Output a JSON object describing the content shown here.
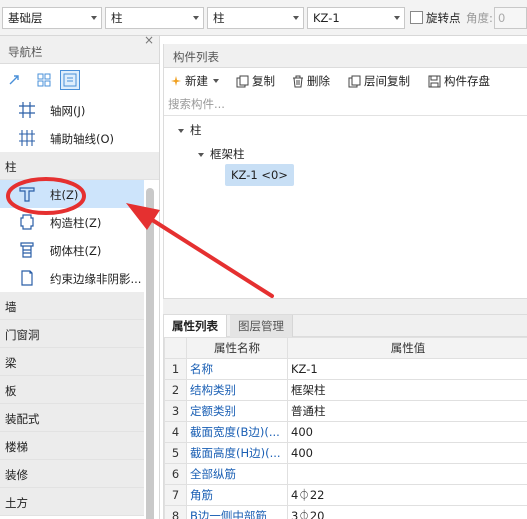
{
  "toolbar": {
    "floor": "基础层",
    "category": "柱",
    "subcategory": "柱",
    "component": "KZ-1",
    "rotate_label": "旋转点",
    "angle_label": "角度:",
    "angle_value": "0"
  },
  "nav": {
    "title": "导航栏",
    "pin": "×",
    "top_items": [
      {
        "label": "轴网(J)",
        "icon": "axis-grid-icon"
      },
      {
        "label": "辅助轴线(O)",
        "icon": "aux-axis-icon"
      }
    ],
    "section_title": "柱",
    "column_items": [
      {
        "label": "柱(Z)",
        "icon": "column-icon"
      },
      {
        "label": "构造柱(Z)",
        "icon": "structural-column-icon"
      },
      {
        "label": "砌体柱(Z)",
        "icon": "masonry-column-icon"
      },
      {
        "label": "约束边缘非阴影...",
        "icon": "constraint-edge-icon"
      }
    ],
    "categories": [
      "墙",
      "门窗洞",
      "梁",
      "板",
      "装配式",
      "楼梯",
      "装修",
      "土方"
    ]
  },
  "component_list": {
    "title": "构件列表",
    "buttons": {
      "new": "新建",
      "copy": "复制",
      "delete": "删除",
      "floor_copy": "层间复制",
      "save": "构件存盘"
    },
    "search_placeholder": "搜索构件...",
    "tree": {
      "root": "柱",
      "child": "框架柱",
      "leaf": "KZ-1 <0>"
    }
  },
  "properties": {
    "tabs": [
      "属性列表",
      "图层管理"
    ],
    "columns": [
      "属性名称",
      "属性值"
    ],
    "rows": [
      {
        "n": "1",
        "name": "名称",
        "value": "KZ-1"
      },
      {
        "n": "2",
        "name": "结构类别",
        "value": "框架柱"
      },
      {
        "n": "3",
        "name": "定额类别",
        "value": "普通柱"
      },
      {
        "n": "4",
        "name": "截面宽度(B边)(...",
        "value": "400"
      },
      {
        "n": "5",
        "name": "截面高度(H边)(...",
        "value": "400"
      },
      {
        "n": "6",
        "name": "全部纵筋",
        "value": ""
      },
      {
        "n": "7",
        "name": "角筋",
        "value": "4⏀22"
      },
      {
        "n": "8",
        "name": "B边一侧中部筋",
        "value": "3⏀20"
      }
    ]
  },
  "colors": {
    "accent": "#4a90d9",
    "selection": "#cde4fb",
    "annotation": "#e53030",
    "link_text": "#1a5fb4"
  }
}
